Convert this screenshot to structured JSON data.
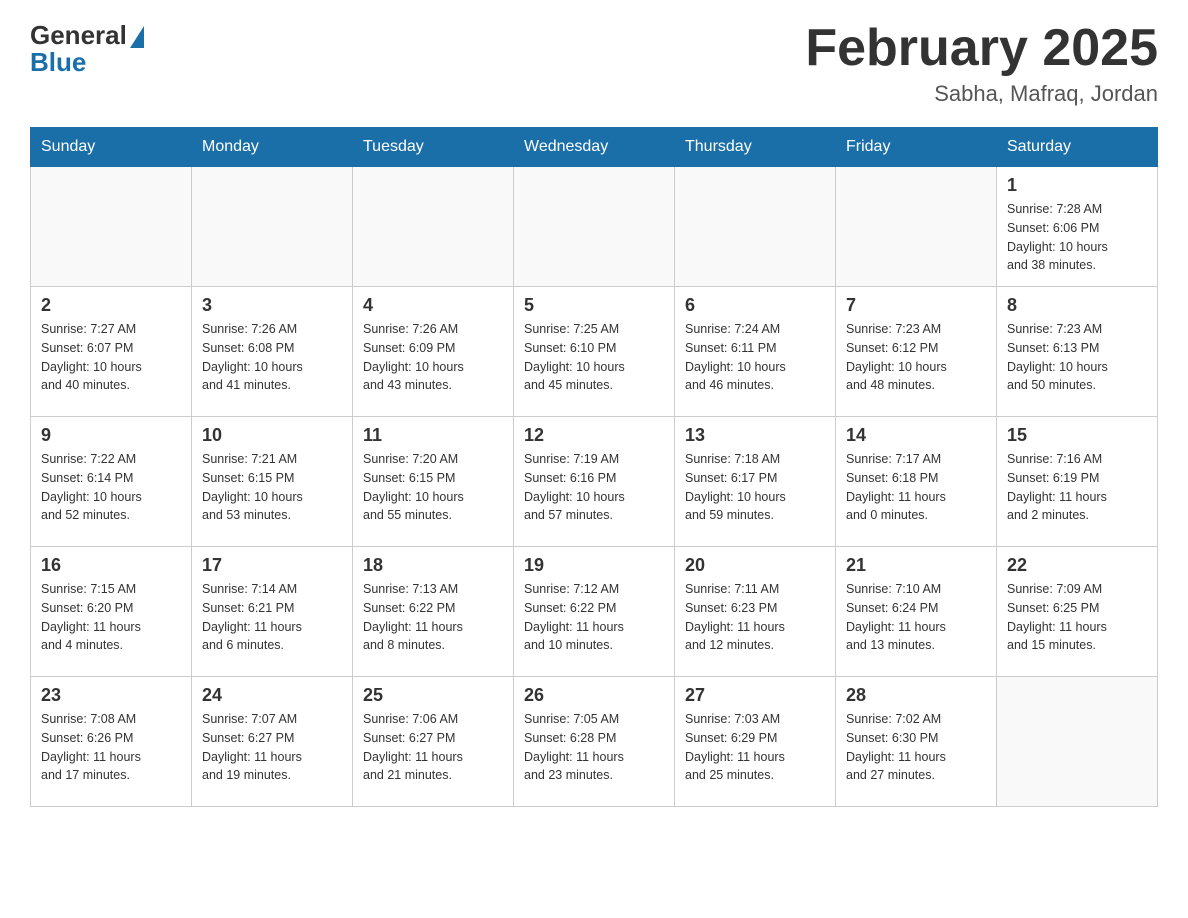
{
  "header": {
    "logo_general": "General",
    "logo_blue": "Blue",
    "month_title": "February 2025",
    "location": "Sabha, Mafraq, Jordan"
  },
  "weekdays": [
    "Sunday",
    "Monday",
    "Tuesday",
    "Wednesday",
    "Thursday",
    "Friday",
    "Saturday"
  ],
  "weeks": [
    [
      {
        "day": "",
        "info": ""
      },
      {
        "day": "",
        "info": ""
      },
      {
        "day": "",
        "info": ""
      },
      {
        "day": "",
        "info": ""
      },
      {
        "day": "",
        "info": ""
      },
      {
        "day": "",
        "info": ""
      },
      {
        "day": "1",
        "info": "Sunrise: 7:28 AM\nSunset: 6:06 PM\nDaylight: 10 hours\nand 38 minutes."
      }
    ],
    [
      {
        "day": "2",
        "info": "Sunrise: 7:27 AM\nSunset: 6:07 PM\nDaylight: 10 hours\nand 40 minutes."
      },
      {
        "day": "3",
        "info": "Sunrise: 7:26 AM\nSunset: 6:08 PM\nDaylight: 10 hours\nand 41 minutes."
      },
      {
        "day": "4",
        "info": "Sunrise: 7:26 AM\nSunset: 6:09 PM\nDaylight: 10 hours\nand 43 minutes."
      },
      {
        "day": "5",
        "info": "Sunrise: 7:25 AM\nSunset: 6:10 PM\nDaylight: 10 hours\nand 45 minutes."
      },
      {
        "day": "6",
        "info": "Sunrise: 7:24 AM\nSunset: 6:11 PM\nDaylight: 10 hours\nand 46 minutes."
      },
      {
        "day": "7",
        "info": "Sunrise: 7:23 AM\nSunset: 6:12 PM\nDaylight: 10 hours\nand 48 minutes."
      },
      {
        "day": "8",
        "info": "Sunrise: 7:23 AM\nSunset: 6:13 PM\nDaylight: 10 hours\nand 50 minutes."
      }
    ],
    [
      {
        "day": "9",
        "info": "Sunrise: 7:22 AM\nSunset: 6:14 PM\nDaylight: 10 hours\nand 52 minutes."
      },
      {
        "day": "10",
        "info": "Sunrise: 7:21 AM\nSunset: 6:15 PM\nDaylight: 10 hours\nand 53 minutes."
      },
      {
        "day": "11",
        "info": "Sunrise: 7:20 AM\nSunset: 6:15 PM\nDaylight: 10 hours\nand 55 minutes."
      },
      {
        "day": "12",
        "info": "Sunrise: 7:19 AM\nSunset: 6:16 PM\nDaylight: 10 hours\nand 57 minutes."
      },
      {
        "day": "13",
        "info": "Sunrise: 7:18 AM\nSunset: 6:17 PM\nDaylight: 10 hours\nand 59 minutes."
      },
      {
        "day": "14",
        "info": "Sunrise: 7:17 AM\nSunset: 6:18 PM\nDaylight: 11 hours\nand 0 minutes."
      },
      {
        "day": "15",
        "info": "Sunrise: 7:16 AM\nSunset: 6:19 PM\nDaylight: 11 hours\nand 2 minutes."
      }
    ],
    [
      {
        "day": "16",
        "info": "Sunrise: 7:15 AM\nSunset: 6:20 PM\nDaylight: 11 hours\nand 4 minutes."
      },
      {
        "day": "17",
        "info": "Sunrise: 7:14 AM\nSunset: 6:21 PM\nDaylight: 11 hours\nand 6 minutes."
      },
      {
        "day": "18",
        "info": "Sunrise: 7:13 AM\nSunset: 6:22 PM\nDaylight: 11 hours\nand 8 minutes."
      },
      {
        "day": "19",
        "info": "Sunrise: 7:12 AM\nSunset: 6:22 PM\nDaylight: 11 hours\nand 10 minutes."
      },
      {
        "day": "20",
        "info": "Sunrise: 7:11 AM\nSunset: 6:23 PM\nDaylight: 11 hours\nand 12 minutes."
      },
      {
        "day": "21",
        "info": "Sunrise: 7:10 AM\nSunset: 6:24 PM\nDaylight: 11 hours\nand 13 minutes."
      },
      {
        "day": "22",
        "info": "Sunrise: 7:09 AM\nSunset: 6:25 PM\nDaylight: 11 hours\nand 15 minutes."
      }
    ],
    [
      {
        "day": "23",
        "info": "Sunrise: 7:08 AM\nSunset: 6:26 PM\nDaylight: 11 hours\nand 17 minutes."
      },
      {
        "day": "24",
        "info": "Sunrise: 7:07 AM\nSunset: 6:27 PM\nDaylight: 11 hours\nand 19 minutes."
      },
      {
        "day": "25",
        "info": "Sunrise: 7:06 AM\nSunset: 6:27 PM\nDaylight: 11 hours\nand 21 minutes."
      },
      {
        "day": "26",
        "info": "Sunrise: 7:05 AM\nSunset: 6:28 PM\nDaylight: 11 hours\nand 23 minutes."
      },
      {
        "day": "27",
        "info": "Sunrise: 7:03 AM\nSunset: 6:29 PM\nDaylight: 11 hours\nand 25 minutes."
      },
      {
        "day": "28",
        "info": "Sunrise: 7:02 AM\nSunset: 6:30 PM\nDaylight: 11 hours\nand 27 minutes."
      },
      {
        "day": "",
        "info": ""
      }
    ]
  ]
}
